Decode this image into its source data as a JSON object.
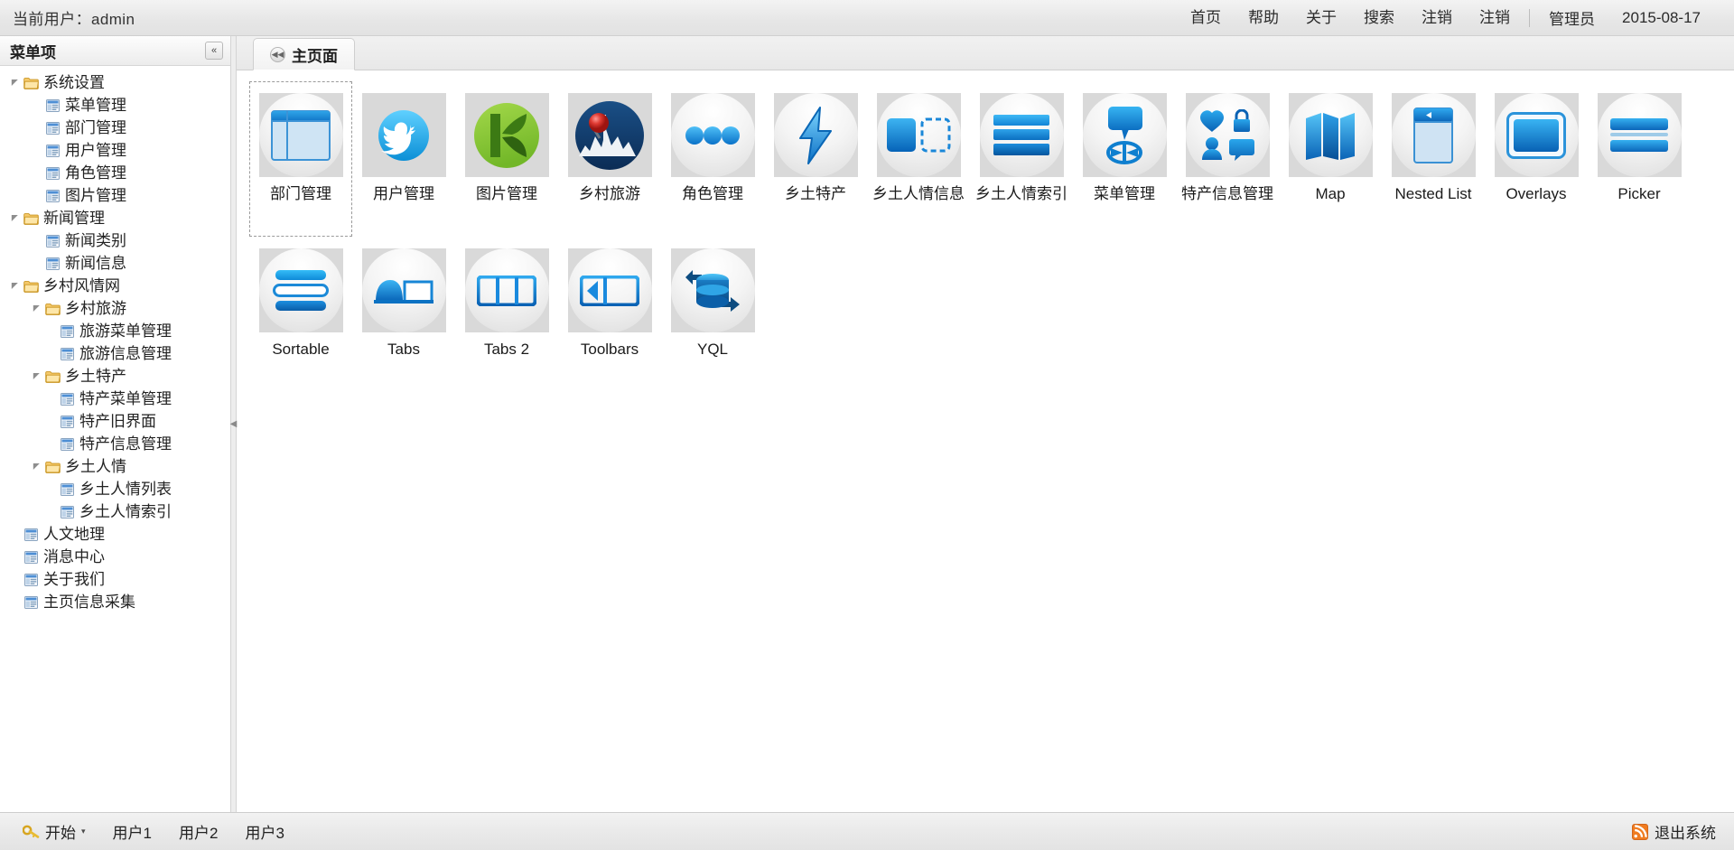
{
  "topbar": {
    "current_user_label": "当前用户：admin",
    "nav": [
      {
        "label": "首页",
        "name": "nav-home"
      },
      {
        "label": "帮助",
        "name": "nav-help"
      },
      {
        "label": "关于",
        "name": "nav-about"
      },
      {
        "label": "搜索",
        "name": "nav-search"
      },
      {
        "label": "注销",
        "name": "nav-logout-1"
      },
      {
        "label": "注销",
        "name": "nav-logout-2"
      }
    ],
    "role_label": "管理员",
    "date_label": "2015-08-17"
  },
  "sidebar": {
    "title": "菜单项",
    "collapse_icon": "«",
    "tree": [
      {
        "label": "系统设置",
        "level": 0,
        "type": "folder",
        "expanded": true
      },
      {
        "label": "菜单管理",
        "level": 1,
        "type": "leaf"
      },
      {
        "label": "部门管理",
        "level": 1,
        "type": "leaf"
      },
      {
        "label": "用户管理",
        "level": 1,
        "type": "leaf"
      },
      {
        "label": "角色管理",
        "level": 1,
        "type": "leaf"
      },
      {
        "label": "图片管理",
        "level": 1,
        "type": "leaf"
      },
      {
        "label": "新闻管理",
        "level": 0,
        "type": "folder",
        "expanded": true
      },
      {
        "label": "新闻类别",
        "level": 1,
        "type": "leaf"
      },
      {
        "label": "新闻信息",
        "level": 1,
        "type": "leaf"
      },
      {
        "label": "乡村风情网",
        "level": 0,
        "type": "folder",
        "expanded": true
      },
      {
        "label": "乡村旅游",
        "level": 1,
        "type": "folder",
        "expanded": true
      },
      {
        "label": "旅游菜单管理",
        "level": 2,
        "type": "leaf"
      },
      {
        "label": "旅游信息管理",
        "level": 2,
        "type": "leaf"
      },
      {
        "label": "乡土特产",
        "level": 1,
        "type": "folder",
        "expanded": true
      },
      {
        "label": "特产菜单管理",
        "level": 2,
        "type": "leaf"
      },
      {
        "label": "特产旧界面",
        "level": 2,
        "type": "leaf"
      },
      {
        "label": "特产信息管理",
        "level": 2,
        "type": "leaf"
      },
      {
        "label": "乡土人情",
        "level": 1,
        "type": "folder",
        "expanded": true
      },
      {
        "label": "乡土人情列表",
        "level": 2,
        "type": "leaf"
      },
      {
        "label": "乡土人情索引",
        "level": 2,
        "type": "leaf"
      },
      {
        "label": "人文地理",
        "level": 0,
        "type": "leaf"
      },
      {
        "label": "消息中心",
        "level": 0,
        "type": "leaf"
      },
      {
        "label": "关于我们",
        "level": 0,
        "type": "leaf"
      },
      {
        "label": "主页信息采集",
        "level": 0,
        "type": "leaf"
      }
    ]
  },
  "main": {
    "tabs": [
      {
        "label": "主页面",
        "icon": "collapse-left-icon",
        "active": true
      }
    ],
    "grid": [
      {
        "label": "部门管理",
        "icon": "panel-layout-icon",
        "selected": true
      },
      {
        "label": "用户管理",
        "icon": "twitter-bird-icon",
        "selected": false
      },
      {
        "label": "图片管理",
        "icon": "green-k-leaf-icon",
        "selected": false
      },
      {
        "label": "乡村旅游",
        "icon": "map-pin-city-icon",
        "selected": false
      },
      {
        "label": "角色管理",
        "icon": "three-dots-icon",
        "selected": false
      },
      {
        "label": "乡土特产",
        "icon": "lightning-bolt-icon",
        "selected": false
      },
      {
        "label": "乡土人情信息",
        "icon": "drag-drop-icon",
        "selected": false
      },
      {
        "label": "乡土人情索引",
        "icon": "stacked-bars-icon",
        "selected": false
      },
      {
        "label": "菜单管理",
        "icon": "speech-target-icon",
        "selected": false
      },
      {
        "label": "特产信息管理",
        "icon": "social-quad-icon",
        "selected": false
      },
      {
        "label": "Map",
        "icon": "folded-map-icon",
        "selected": false
      },
      {
        "label": "Nested List",
        "icon": "nested-list-icon",
        "selected": false
      },
      {
        "label": "Overlays",
        "icon": "overlay-window-icon",
        "selected": false
      },
      {
        "label": "Picker",
        "icon": "picker-rows-icon",
        "selected": false
      },
      {
        "label": "Sortable",
        "icon": "sortable-rows-icon",
        "selected": false
      },
      {
        "label": "Tabs",
        "icon": "tabs-icon",
        "selected": false
      },
      {
        "label": "Tabs 2",
        "icon": "tabs2-icon",
        "selected": false
      },
      {
        "label": "Toolbars",
        "icon": "toolbars-icon",
        "selected": false
      },
      {
        "label": "YQL",
        "icon": "yql-database-icon",
        "selected": false
      }
    ]
  },
  "taskbar": {
    "start_label": "开始",
    "start_icon": "key-icon",
    "start_caret": "▾",
    "items": [
      {
        "label": "用户1",
        "name": "taskbar-item-user1"
      },
      {
        "label": "用户2",
        "name": "taskbar-item-user2"
      },
      {
        "label": "用户3",
        "name": "taskbar-item-user3"
      }
    ],
    "logout_label": "退出系统",
    "logout_icon": "exit-icon"
  },
  "colors": {
    "accent_blue": "#1a8fe0",
    "deep_blue": "#0a5fb0",
    "chrome_grey": "#e6e6e6",
    "thumb_bg": "#d9d9d9"
  }
}
